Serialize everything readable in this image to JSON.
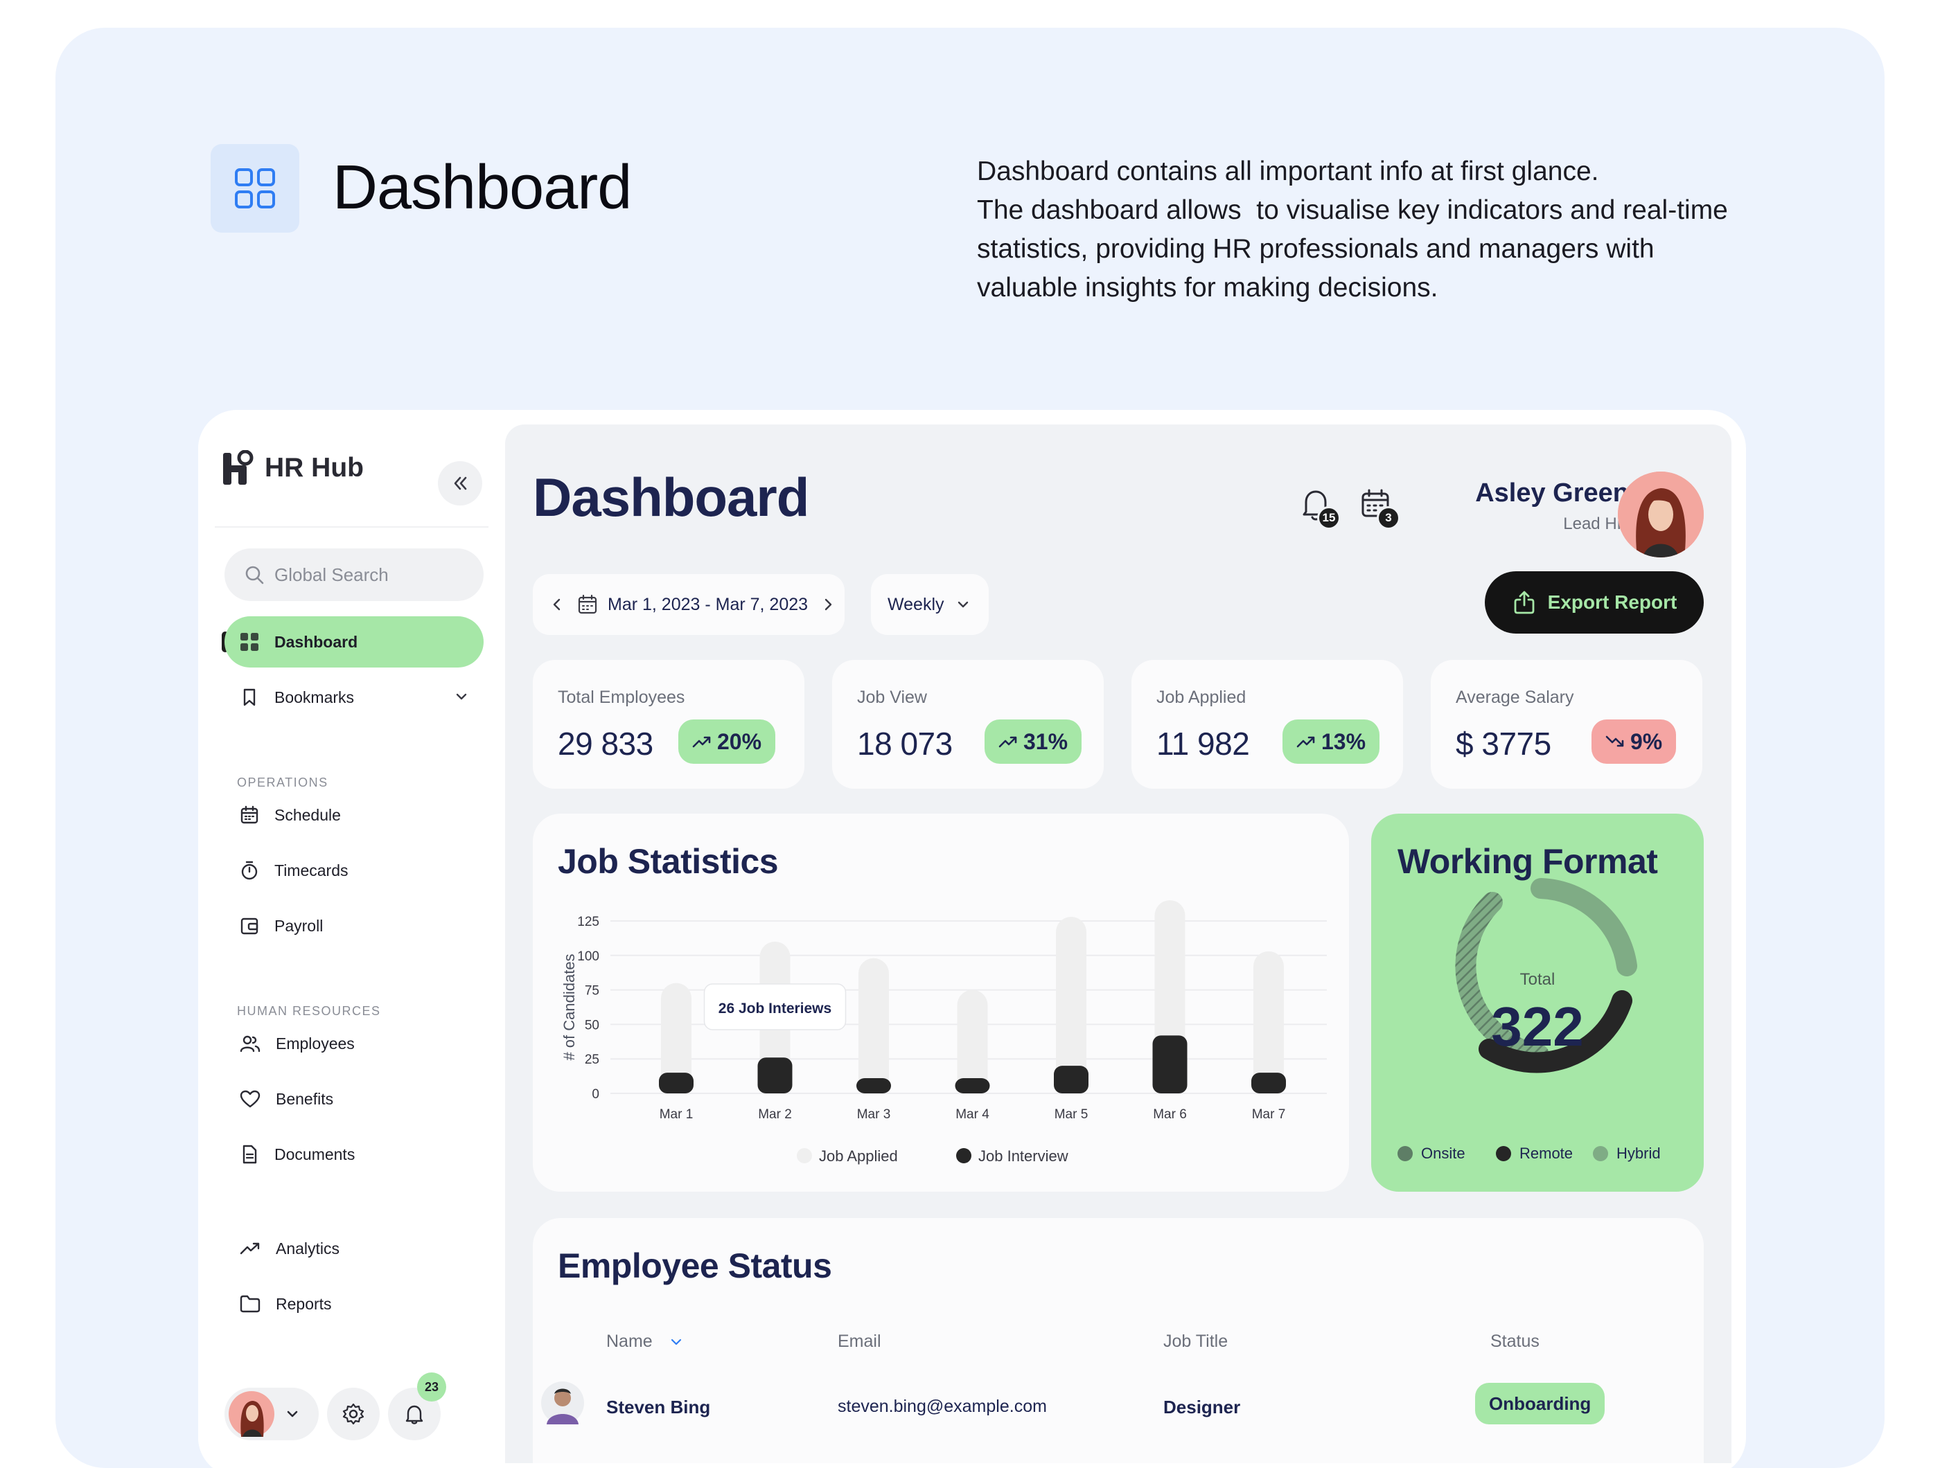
{
  "hero": {
    "title": "Dashboard",
    "description_lines": [
      "Dashboard contains all important info at first glance.",
      "The dashboard allows  to visualise key indicators and real-time",
      "statistics, providing HR professionals and managers with",
      "valuable insights for making decisions."
    ]
  },
  "sidebar": {
    "brand": "HR Hub",
    "search_placeholder": "Global Search",
    "items": [
      {
        "label": "Dashboard",
        "icon": "grid-icon"
      },
      {
        "label": "Bookmarks",
        "icon": "bookmark-icon"
      }
    ],
    "sections": [
      {
        "label": "OPERATIONS",
        "items": [
          {
            "label": "Schedule",
            "icon": "calendar-icon"
          },
          {
            "label": "Timecards",
            "icon": "stopwatch-icon"
          },
          {
            "label": "Payroll",
            "icon": "wallet-icon"
          }
        ]
      },
      {
        "label": "HUMAN RESOURCES",
        "items": [
          {
            "label": "Employees",
            "icon": "users-icon"
          },
          {
            "label": "Benefits",
            "icon": "heart-icon"
          },
          {
            "label": "Documents",
            "icon": "document-icon"
          }
        ]
      }
    ],
    "extra_items": [
      {
        "label": "Analytics",
        "icon": "trend-icon"
      },
      {
        "label": "Reports",
        "icon": "folder-icon"
      }
    ],
    "notification_count": "23"
  },
  "header": {
    "title": "Dashboard",
    "bell_count": "15",
    "calendar_count": "3",
    "user_name": "Asley Green",
    "user_role": "Lead HR",
    "date_range": "Mar 1, 2023 - Mar 7, 2023",
    "period": "Weekly",
    "export_label": "Export Report"
  },
  "kpis": [
    {
      "label": "Total Employees",
      "value": "29 833",
      "change": "20%",
      "direction": "up"
    },
    {
      "label": "Job View",
      "value": "18 073",
      "change": "31%",
      "direction": "up"
    },
    {
      "label": "Job Applied",
      "value": "11 982",
      "change": "13%",
      "direction": "up"
    },
    {
      "label": "Average Salary",
      "value": "$ 3775",
      "change": "9%",
      "direction": "down"
    }
  ],
  "job_statistics": {
    "title": "Job Statistics",
    "tooltip": "26 Job Interiews",
    "chart_data": {
      "type": "bar",
      "ylabel": "# of Candidates",
      "ylim": [
        0,
        125
      ],
      "yticks": [
        0,
        25,
        50,
        75,
        100,
        125
      ],
      "categories": [
        "Mar 1",
        "Mar 2",
        "Mar 3",
        "Mar 4",
        "Mar 5",
        "Mar 6",
        "Mar 7"
      ],
      "series": [
        {
          "name": "Job Applied",
          "values": [
            80,
            110,
            98,
            75,
            128,
            140,
            103
          ],
          "color": "#efefef"
        },
        {
          "name": "Job Interview",
          "values": [
            15,
            26,
            11,
            6,
            20,
            42,
            15
          ],
          "color": "#262626"
        }
      ]
    }
  },
  "working_format": {
    "title": "Working Format",
    "total_label": "Total",
    "total": "322",
    "legend": [
      {
        "label": "Onsite",
        "color": "#5e7e66"
      },
      {
        "label": "Remote",
        "color": "#262626"
      },
      {
        "label": "Hybrid",
        "color": "#7fac85"
      }
    ]
  },
  "employee_status": {
    "title": "Employee Status",
    "columns": [
      "Name",
      "Email",
      "Job Title",
      "Status"
    ],
    "rows": [
      {
        "name": "Steven Bing",
        "email": "steven.bing@example.com",
        "job_title": "Designer",
        "status": "Onboarding"
      }
    ]
  }
}
